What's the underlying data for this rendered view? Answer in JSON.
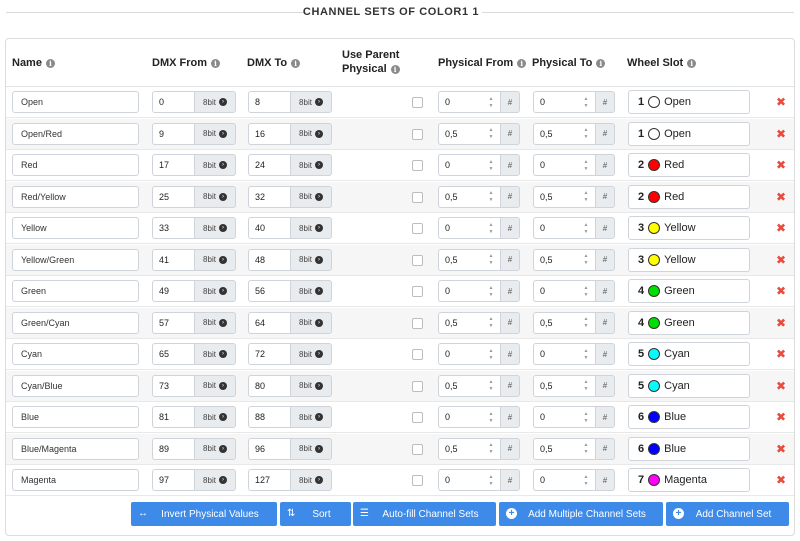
{
  "title": "CHANNEL SETS OF COLOR1 1",
  "headers": {
    "name": "Name",
    "dmx_from": "DMX From",
    "dmx_to": "DMX To",
    "use_parent_1": "Use Parent",
    "use_parent_2": "Physical",
    "phys_from": "Physical From",
    "phys_to": "Physical To",
    "wheel_slot": "Wheel Slot"
  },
  "info_icon": "i",
  "bit_label": "8bit",
  "hash_label": "#",
  "delete_icon": "✖",
  "rows": [
    {
      "name": "Open",
      "dmx_from": "0",
      "dmx_to": "8",
      "phys_from": "0",
      "phys_to": "0",
      "slot_num": "1",
      "slot_color": "#ffffff",
      "slot_name": "Open"
    },
    {
      "name": "Open/Red",
      "dmx_from": "9",
      "dmx_to": "16",
      "phys_from": "0,5",
      "phys_to": "0,5",
      "slot_num": "1",
      "slot_color": "#ffffff",
      "slot_name": "Open"
    },
    {
      "name": "Red",
      "dmx_from": "17",
      "dmx_to": "24",
      "phys_from": "0",
      "phys_to": "0",
      "slot_num": "2",
      "slot_color": "#ff0000",
      "slot_name": "Red"
    },
    {
      "name": "Red/Yellow",
      "dmx_from": "25",
      "dmx_to": "32",
      "phys_from": "0,5",
      "phys_to": "0,5",
      "slot_num": "2",
      "slot_color": "#ff0000",
      "slot_name": "Red"
    },
    {
      "name": "Yellow",
      "dmx_from": "33",
      "dmx_to": "40",
      "phys_from": "0",
      "phys_to": "0",
      "slot_num": "3",
      "slot_color": "#ffff00",
      "slot_name": "Yellow"
    },
    {
      "name": "Yellow/Green",
      "dmx_from": "41",
      "dmx_to": "48",
      "phys_from": "0,5",
      "phys_to": "0,5",
      "slot_num": "3",
      "slot_color": "#ffff00",
      "slot_name": "Yellow"
    },
    {
      "name": "Green",
      "dmx_from": "49",
      "dmx_to": "56",
      "phys_from": "0",
      "phys_to": "0",
      "slot_num": "4",
      "slot_color": "#00e000",
      "slot_name": "Green"
    },
    {
      "name": "Green/Cyan",
      "dmx_from": "57",
      "dmx_to": "64",
      "phys_from": "0,5",
      "phys_to": "0,5",
      "slot_num": "4",
      "slot_color": "#00e000",
      "slot_name": "Green"
    },
    {
      "name": "Cyan",
      "dmx_from": "65",
      "dmx_to": "72",
      "phys_from": "0",
      "phys_to": "0",
      "slot_num": "5",
      "slot_color": "#00ffff",
      "slot_name": "Cyan"
    },
    {
      "name": "Cyan/Blue",
      "dmx_from": "73",
      "dmx_to": "80",
      "phys_from": "0,5",
      "phys_to": "0,5",
      "slot_num": "5",
      "slot_color": "#00ffff",
      "slot_name": "Cyan"
    },
    {
      "name": "Blue",
      "dmx_from": "81",
      "dmx_to": "88",
      "phys_from": "0",
      "phys_to": "0",
      "slot_num": "6",
      "slot_color": "#0000ff",
      "slot_name": "Blue"
    },
    {
      "name": "Blue/Magenta",
      "dmx_from": "89",
      "dmx_to": "96",
      "phys_from": "0,5",
      "phys_to": "0,5",
      "slot_num": "6",
      "slot_color": "#0000ff",
      "slot_name": "Blue"
    },
    {
      "name": "Magenta",
      "dmx_from": "97",
      "dmx_to": "127",
      "phys_from": "0",
      "phys_to": "0",
      "slot_num": "7",
      "slot_color": "#ff00ff",
      "slot_name": "Magenta"
    }
  ],
  "buttons": {
    "invert": "Invert Physical Values",
    "sort": "Sort",
    "autofill": "Auto-fill Channel Sets",
    "add_multiple": "Add Multiple Channel Sets",
    "add": "Add Channel Set"
  },
  "colors": {
    "accent": "#3e8ae8",
    "delete": "#e74c3c"
  }
}
